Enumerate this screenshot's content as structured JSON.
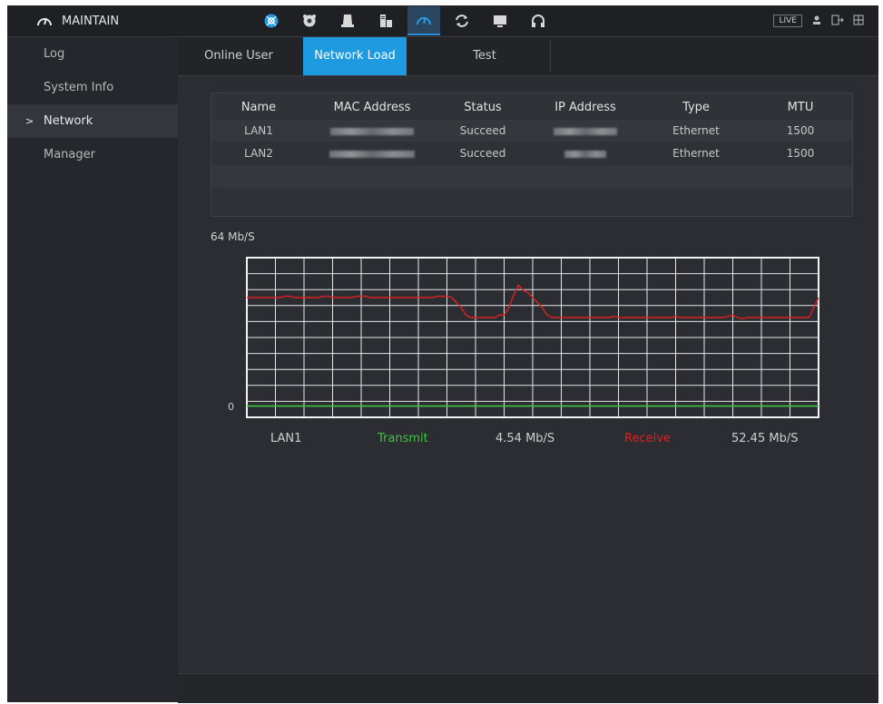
{
  "header": {
    "title": "MAINTAIN",
    "live_label": "LIVE",
    "icons": [
      "maintain-gauge-icon",
      "network-icon",
      "camera-icon",
      "storage-icon",
      "server-icon",
      "maintain-icon",
      "refresh-icon",
      "monitor-icon",
      "headset-icon"
    ],
    "active_icon": "maintain-icon",
    "accent_color": "#1e9ae0"
  },
  "sidebar": {
    "items": [
      {
        "label": "Log"
      },
      {
        "label": "System Info"
      },
      {
        "label": "Network",
        "active": true,
        "caret": ">"
      },
      {
        "label": "Manager"
      }
    ]
  },
  "tabs": [
    {
      "label": "Online User"
    },
    {
      "label": "Network Load",
      "selected": true
    },
    {
      "label": "Test"
    }
  ],
  "table": {
    "columns": [
      "Name",
      "MAC Address",
      "Status",
      "IP Address",
      "Type",
      "MTU"
    ],
    "rows": [
      {
        "name": "LAN1",
        "status": "Succeed",
        "type": "Ethernet",
        "mtu": "1500"
      },
      {
        "name": "LAN2",
        "status": "Succeed",
        "type": "Ethernet",
        "mtu": "1500"
      }
    ]
  },
  "chart_data": {
    "type": "line",
    "y_max_label": "64 Mb/S",
    "y_min_label": "0",
    "ylim": [
      0,
      64
    ],
    "grid": true,
    "series": [
      {
        "name": "Receive",
        "color": "#e02020",
        "values": [
          48,
          48,
          48,
          48,
          48,
          48,
          48,
          48,
          48.5,
          48.5,
          48,
          48,
          48,
          48,
          48,
          48,
          48.5,
          48.5,
          48,
          48,
          48,
          48,
          48,
          48.5,
          48.5,
          48.5,
          48,
          48,
          48,
          48,
          48,
          48,
          48,
          48,
          48,
          48,
          48,
          48,
          48,
          48,
          48.5,
          48.5,
          48.5,
          48,
          46,
          44,
          41,
          40,
          40,
          40,
          40,
          40,
          40,
          41,
          41,
          44,
          49,
          53,
          51,
          50,
          48,
          46,
          44,
          41,
          40,
          40,
          40,
          40,
          40,
          40,
          40,
          40,
          40,
          40,
          40,
          40,
          40,
          40.5,
          40,
          40,
          40,
          40,
          40,
          40,
          40,
          40,
          40,
          40,
          40,
          40,
          40.5,
          40,
          40,
          40,
          40,
          40,
          40,
          40,
          40,
          40,
          40,
          40.5,
          41,
          40,
          39.5,
          40,
          40,
          40,
          40,
          40,
          40,
          40,
          40,
          40,
          40,
          40,
          40,
          40,
          40,
          44,
          48
        ]
      },
      {
        "name": "Transmit",
        "color": "#3ec43e",
        "values": [
          4.5,
          4.5,
          4.5,
          4.5,
          4.5,
          4.5,
          4.5,
          4.5,
          4.5,
          4.5,
          4.5,
          4.5,
          4.5,
          4.5,
          4.5,
          4.5,
          4.5,
          4.5,
          4.5,
          4.5
        ]
      }
    ],
    "legend": {
      "interface": "LAN1",
      "transmit_label": "Transmit",
      "transmit_value": "4.54 Mb/S",
      "receive_label": "Receive",
      "receive_value": "52.45 Mb/S"
    }
  }
}
